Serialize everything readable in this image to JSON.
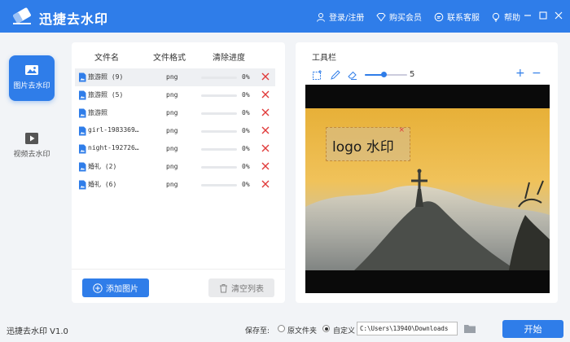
{
  "app": {
    "title": "迅捷去水印",
    "version": "迅捷去水印 V1.0"
  },
  "topnav": {
    "login": "登录/注册",
    "buy": "购买会员",
    "support": "联系客服",
    "help": "帮助"
  },
  "sidebar": {
    "items": [
      {
        "label": "图片去水印",
        "active": true
      },
      {
        "label": "视频去水印",
        "active": false
      }
    ]
  },
  "filelist": {
    "headers": {
      "name": "文件名",
      "format": "文件格式",
      "progress": "清除进度"
    },
    "rows": [
      {
        "name": "旅游照 (9)",
        "format": "png",
        "progress": 0,
        "progress_label": "0%"
      },
      {
        "name": "旅游照 (5)",
        "format": "png",
        "progress": 0,
        "progress_label": "0%"
      },
      {
        "name": "旅游照",
        "format": "png",
        "progress": 0,
        "progress_label": "0%"
      },
      {
        "name": "girl-1983369…",
        "format": "png",
        "progress": 0,
        "progress_label": "0%"
      },
      {
        "name": "night-192726…",
        "format": "png",
        "progress": 0,
        "progress_label": "0%"
      },
      {
        "name": "婚礼 (2)",
        "format": "png",
        "progress": 0,
        "progress_label": "0%"
      },
      {
        "name": "婚礼 (6)",
        "format": "png",
        "progress": 0,
        "progress_label": "0%"
      }
    ],
    "add_label": "添加图片",
    "clear_label": "清空列表"
  },
  "toolbar": {
    "title": "工具栏",
    "brush_size": 5,
    "brush_size_label": "5",
    "zoom_in": "+",
    "zoom_out": "−"
  },
  "preview": {
    "watermark_text": "logo 水印",
    "watermark_close": "×"
  },
  "statusbar": {
    "save_to": "保存至:",
    "option_source": "原文件夹",
    "option_custom": "自定义",
    "selected_option": "custom",
    "path": "C:\\Users\\13940\\Downloads",
    "start_label": "开始"
  },
  "colors": {
    "primary": "#2f7de9",
    "delete": "#e03a3a"
  }
}
